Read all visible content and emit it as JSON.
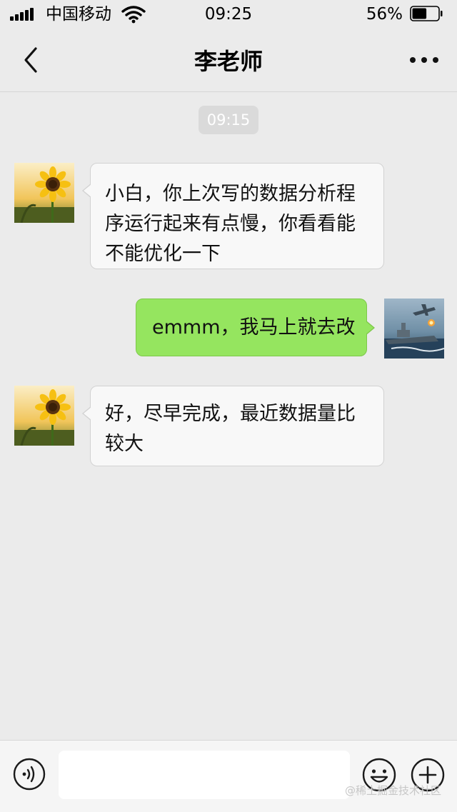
{
  "status_bar": {
    "carrier": "中国移动",
    "time": "09:25",
    "battery_percent": "56%",
    "battery_level": 0.56
  },
  "nav": {
    "title": "李老师",
    "back_icon": "chevron-left-icon",
    "more_icon": "more-dots-icon"
  },
  "chat": {
    "timestamp": "09:15",
    "messages": [
      {
        "sender": "other",
        "text": "小白，你上次写的数据分析程序运行起来有点慢，你看看能不能优化一下"
      },
      {
        "sender": "me",
        "text": "emmm，我马上就去改"
      },
      {
        "sender": "other",
        "text": "好，尽早完成，最近数据量比较大"
      }
    ]
  },
  "input_bar": {
    "placeholder": "",
    "value": "",
    "voice_icon": "voice-icon",
    "emoji_icon": "emoji-icon",
    "plus_icon": "plus-icon"
  },
  "watermark": "@稀土掘金技术社区",
  "colors": {
    "background": "#ebebeb",
    "my_bubble": "#95e55f",
    "other_bubble": "#f8f8f8"
  }
}
